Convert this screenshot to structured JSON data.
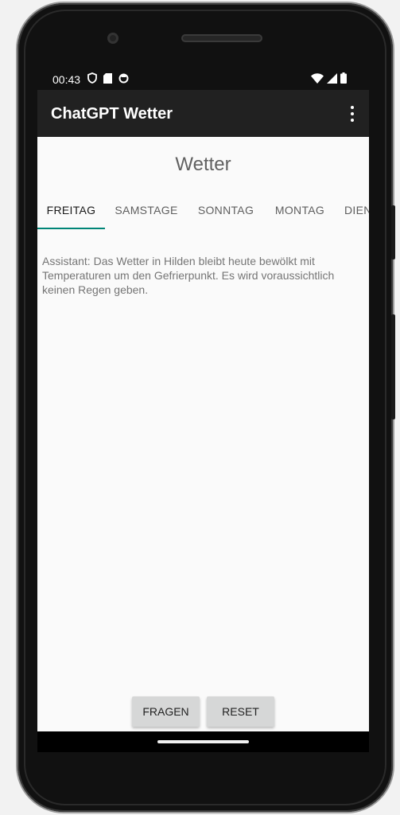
{
  "status_bar": {
    "time": "00:43",
    "left_icons": [
      "shield-icon",
      "sd-card-icon",
      "circle-app-icon"
    ],
    "right_icons": [
      "wifi-icon",
      "signal-icon",
      "battery-icon"
    ]
  },
  "app_bar": {
    "title": "ChatGPT Wetter",
    "overflow_icon": "more-vert-icon"
  },
  "main": {
    "heading": "Wetter",
    "tabs": [
      {
        "label": "FREITAG",
        "active": true
      },
      {
        "label": "SAMSTAGE",
        "active": false
      },
      {
        "label": "SONNTAG",
        "active": false
      },
      {
        "label": "MONTAG",
        "active": false
      },
      {
        "label": "DIEN",
        "active": false
      }
    ],
    "message": "Assistant: Das Wetter in Hilden bleibt heute bewölkt mit Temperaturen um den Gefrierpunkt. Es wird voraussichtlich keinen Regen geben."
  },
  "actions": {
    "ask_label": "FRAGEN",
    "reset_label": "RESET"
  },
  "colors": {
    "app_bar": "#212121",
    "tab_indicator": "#008577",
    "content_bg": "#fafafa",
    "button_bg": "#d6d7d7"
  }
}
